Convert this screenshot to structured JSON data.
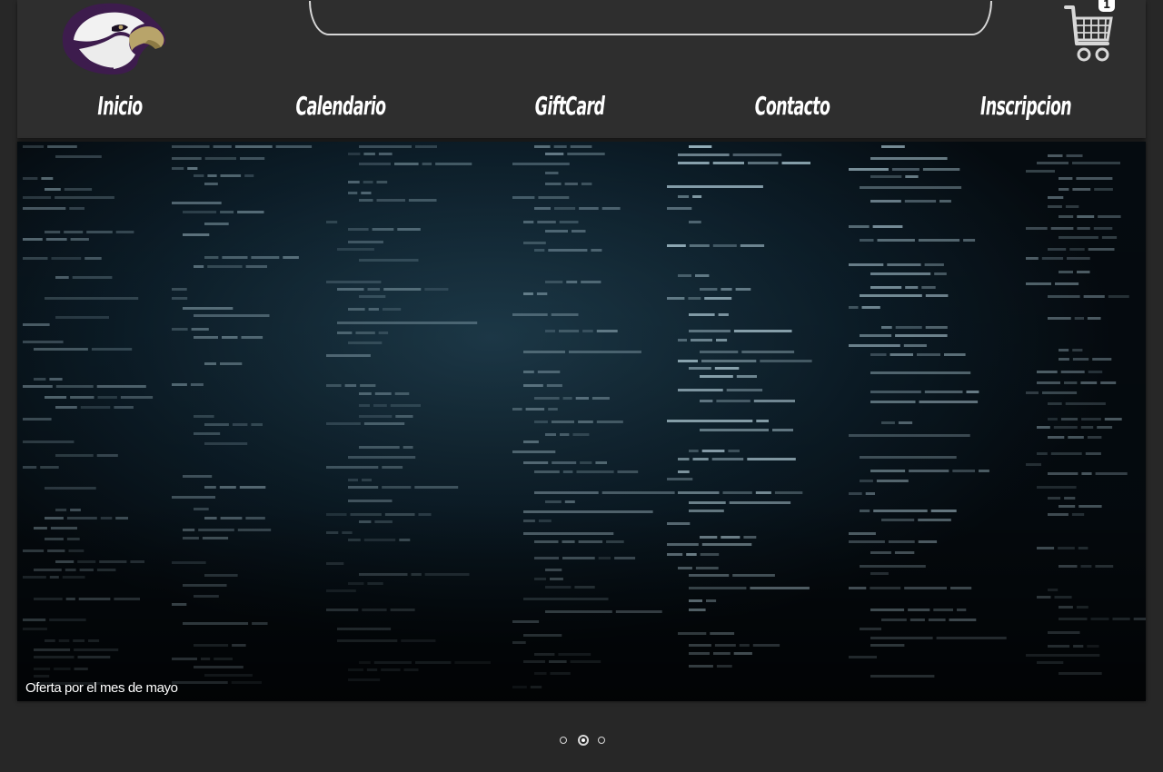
{
  "header": {
    "logo_icon": "eagle-head-logo",
    "search": {
      "value": "",
      "placeholder": ""
    },
    "cart": {
      "icon": "shopping-cart-icon",
      "badge": "1"
    }
  },
  "nav": {
    "items": [
      {
        "label": "Inicio"
      },
      {
        "label": "Calendario"
      },
      {
        "label": "GiftCard"
      },
      {
        "label": "Contacto"
      },
      {
        "label": "Inscripcion"
      }
    ]
  },
  "slider": {
    "caption": "Oferta por el mes de mayo",
    "background": "dark-code-screen",
    "slide_count": 3,
    "active_slide": 2
  },
  "colors": {
    "page_bg": "#272727",
    "header_bg": "#2e2e2e",
    "nav_text": "#ffffff",
    "logo_purple": "#3d1c4d",
    "logo_gold": "#b8a46a"
  }
}
